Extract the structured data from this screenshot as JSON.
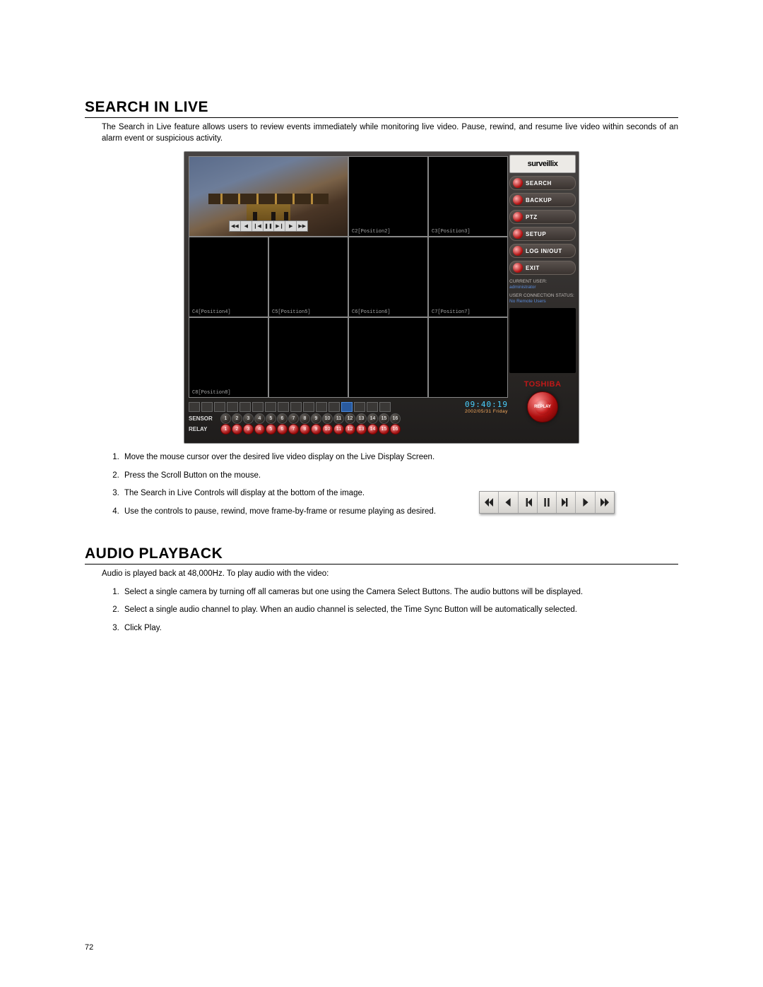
{
  "page_number": "72",
  "section1": {
    "title": "SEARCH IN LIVE",
    "intro": "The Search in Live feature allows users to review events immediately while monitoring live video.  Pause, rewind, and resume live video within seconds of an alarm event or suspicious activity.",
    "steps": [
      "Move the mouse cursor over the desired live video display on the Live Display Screen.",
      "Press the Scroll Button on the mouse.",
      "The Search in Live Controls will display at the bottom of the image.",
      "Use the controls to pause, rewind, move frame-by-frame or resume playing as desired."
    ]
  },
  "section2": {
    "title": "AUDIO PLAYBACK",
    "intro": "Audio is played back at 48,000Hz.  To play audio with the video:",
    "steps": [
      "Select a single camera by turning off all cameras but one using the Camera Select Buttons.  The audio buttons will be displayed.",
      "Select a single audio channel to play.  When an audio channel is selected, the Time Sync Button will be automatically selected.",
      "Click Play."
    ]
  },
  "dvr": {
    "logo": "surveillix",
    "side_buttons": [
      "SEARCH",
      "BACKUP",
      "PTZ",
      "SETUP",
      "LOG IN/OUT",
      "EXIT"
    ],
    "status": {
      "current_user_label": "CURRENT USER:",
      "current_user": "administrator",
      "conn_label": "USER CONNECTION STATUS:",
      "conn": "No Remote Users"
    },
    "brand": "TOSHIBA",
    "replay": "REPLAY",
    "clock": "09:40:19",
    "date": "2002/05/31  Friday",
    "sensor_label": "SENSOR",
    "relay_label": "RELAY",
    "numbers_16": [
      "1",
      "2",
      "3",
      "4",
      "5",
      "6",
      "7",
      "8",
      "9",
      "10",
      "11",
      "12",
      "13",
      "14",
      "15",
      "16"
    ],
    "cell_labels": [
      "",
      "C2[Position2]",
      "C3[Position3]",
      "C4[Position4]",
      "C5[Position5]",
      "C6[Position6]",
      "C7[Position7]",
      "C8[Position8]"
    ],
    "mini_controls": [
      "◀◀",
      "◀",
      "❙◀",
      "❚❚",
      "▶❙",
      "▶",
      "▶▶"
    ],
    "layout_count": 16
  },
  "controlbar_icons": [
    "rewind",
    "step-back",
    "prev",
    "pause",
    "next",
    "step-fwd",
    "fast-fwd"
  ]
}
